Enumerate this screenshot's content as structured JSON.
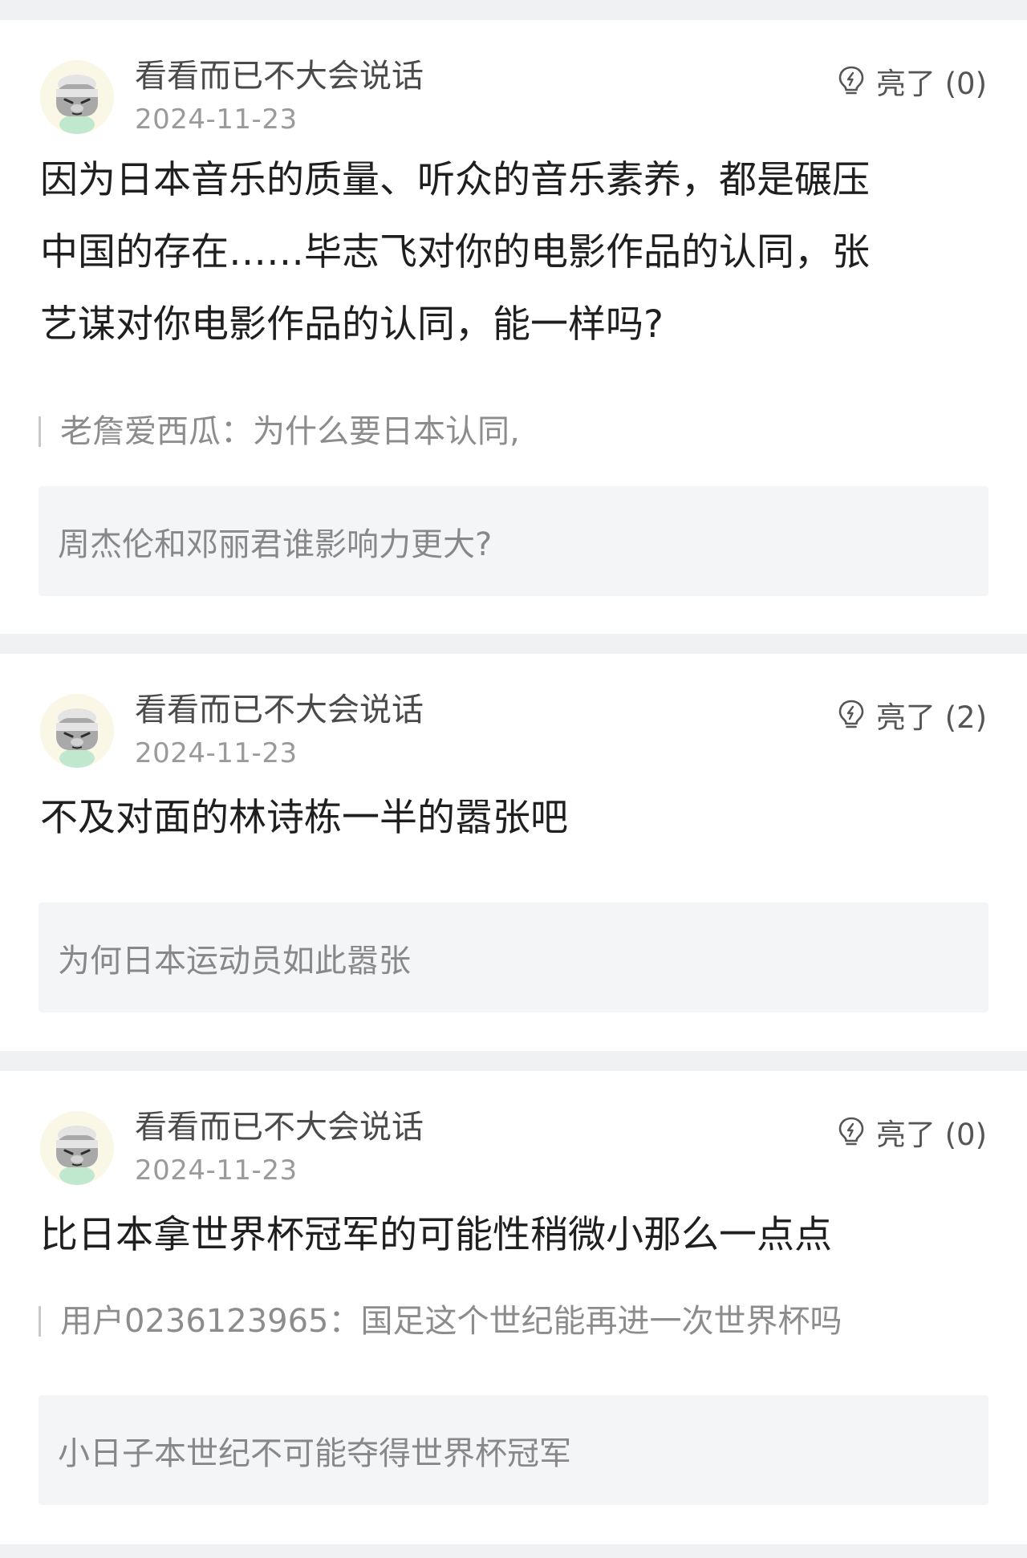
{
  "posts": [
    {
      "username": "看看而已不大会说话",
      "date": "2024-11-23",
      "like_label": "亮了 (0)",
      "content_lines": [
        "因为日本音乐的质量、听众的音乐素养，都是碾压",
        "中国的存在……毕志飞对你的电影作品的认同，张",
        "艺谋对你电影作品的认同，能一样吗?"
      ],
      "quote": "老詹爱西瓜：为什么要日本认同,",
      "question": "周杰伦和邓丽君谁影响力更大?",
      "icons": {
        "avatar": "avatar-icon",
        "like": "lightbulb-icon"
      }
    },
    {
      "username": "看看而已不大会说话",
      "date": "2024-11-23",
      "like_label": "亮了 (2)",
      "content_lines": [
        "不及对面的林诗栋一半的嚣张吧"
      ],
      "question": "为何日本运动员如此嚣张",
      "icons": {
        "avatar": "avatar-icon",
        "like": "lightbulb-icon"
      }
    },
    {
      "username": "看看而已不大会说话",
      "date": "2024-11-23",
      "like_label": "亮了 (0)",
      "content_lines": [
        "比日本拿世界杯冠军的可能性稍微小那么一点点"
      ],
      "quote": "用户0236123965：国足这个世纪能再进一次世界杯吗",
      "question": "小日子本世纪不可能夺得世界杯冠军",
      "icons": {
        "avatar": "avatar-icon",
        "like": "lightbulb-icon"
      }
    }
  ],
  "colors": {
    "page_background": "#f0f1f3",
    "card_background": "#ffffff",
    "question_background": "#f4f5f7",
    "primary_text": "#1f1f1f",
    "secondary_text": "#9a9a9a"
  }
}
